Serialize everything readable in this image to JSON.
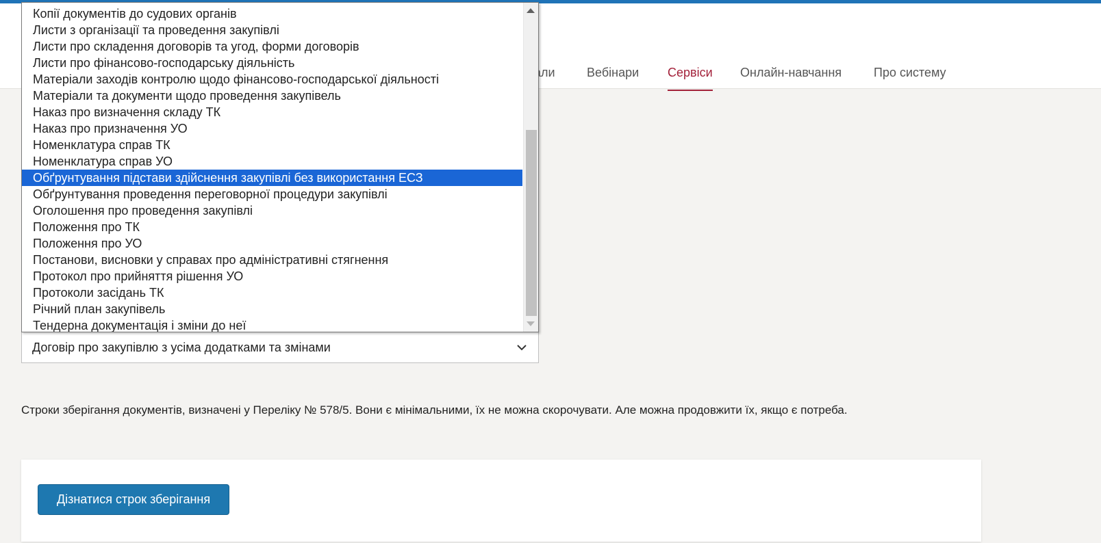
{
  "nav": {
    "items": [
      {
        "label": "али",
        "active": false
      },
      {
        "label": "Вебінари",
        "active": false
      },
      {
        "label": "Сервіси",
        "active": true
      },
      {
        "label": "Онлайн-навчання",
        "active": false
      },
      {
        "label": "Про систему",
        "active": false
      }
    ]
  },
  "dropdown": {
    "options": [
      "Копії документів до судових органів",
      "Листи з організації та проведення закупівлі",
      "Листи про складення договорів та угод, форми договорів",
      "Листи про фінансово-господарську діяльність",
      "Матеріали заходів контролю щодо фінансово-господарської діяльності",
      "Матеріали та документи щодо проведення закупівель",
      "Наказ про визначення складу ТК",
      "Наказ про призначення УО",
      "Номенклатура справ ТК",
      "Номенклатура справ УО",
      "Обґрунтування підстави здійснення закупівлі без використання ЕСЗ",
      "Обґрунтування проведення переговорної процедури закупівлі",
      "Оголошення про проведення закупівлі",
      "Положення про ТК",
      "Положення про УО",
      "Постанови, висновки у справах про адміністративні стягнення",
      "Протокол про прийняття рішення УО",
      "Протоколи засідань ТК",
      "Річний план закупівель",
      "Тендерна документація і зміни до неї"
    ],
    "highlighted": "Обґрунтування підстави здійснення закупівлі без використання ЕСЗ",
    "selected_value": "Договір про закупівлю з усіма додатками та змінами"
  },
  "info": {
    "text": "Строки зберігання документів, визначені у Переліку № 578/5. Вони є мінімальними, їх не можна скорочувати. Але можна продовжити їх, якщо є потреба."
  },
  "action": {
    "button_label": "Дізнатися строк зберігання"
  },
  "colors": {
    "accent": "#1f73b7",
    "active_nav": "#a3213a",
    "highlight": "#1a66d6",
    "button": "#1e78b0"
  }
}
